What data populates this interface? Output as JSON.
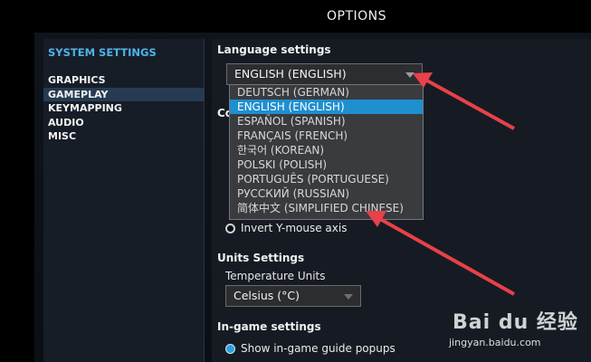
{
  "header": {
    "title": "OPTIONS"
  },
  "sidebar": {
    "heading": "SYSTEM SETTINGS",
    "items": [
      {
        "label": "GRAPHICS",
        "active": false
      },
      {
        "label": "GAMEPLAY",
        "active": true
      },
      {
        "label": "KEYMAPPING",
        "active": false
      },
      {
        "label": "AUDIO",
        "active": false
      },
      {
        "label": "MISC",
        "active": false
      }
    ]
  },
  "language": {
    "section_title": "Language settings",
    "selected": "ENGLISH (ENGLISH)",
    "options": [
      "DEUTSCH (GERMAN)",
      "ENGLISH (ENGLISH)",
      "ESPAÑOL (SPANISH)",
      "FRANÇAIS (FRENCH)",
      "한국어 (KOREAN)",
      "POLSKI (POLISH)",
      "PORTUGUÊS (PORTUGUESE)",
      "РУССКИЙ (RUSSIAN)",
      "简体中文 (SIMPLIFIED CHINESE)"
    ]
  },
  "controls": {
    "section_title_partial": "Co",
    "invert_label": "Invert Y-mouse axis"
  },
  "units": {
    "section_title": "Units Settings",
    "temperature_label": "Temperature Units",
    "temperature_value": "Celsius (°C)"
  },
  "ingame": {
    "section_title": "In-game settings",
    "guide_popups_label": "Show in-game guide popups"
  },
  "watermark": {
    "logo": "Bai du 经验",
    "url": "jingyan.baidu.com"
  },
  "colors": {
    "accent": "#4fb3e8",
    "selected_option": "#1f8fcf",
    "arrow": "#e8414a"
  }
}
